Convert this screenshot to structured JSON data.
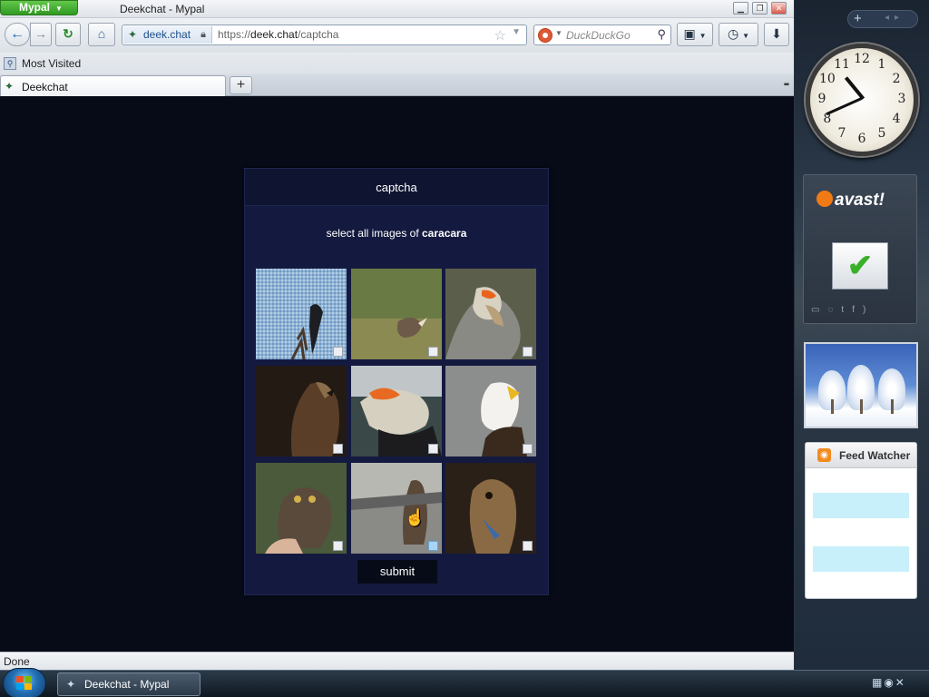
{
  "window": {
    "app_button": "Mypal",
    "title": "Deekchat - Mypal",
    "controls": {
      "minimize": "▁",
      "restore": "❐",
      "close": "✕"
    }
  },
  "navbar": {
    "back_icon": "←",
    "forward_icon": "→",
    "reload_icon": "↻",
    "home_icon": "⌂",
    "identity_site": "deek.chat",
    "url_prefix": "https://",
    "url_host": "deek.chat",
    "url_path": "/captcha",
    "search_placeholder": "DuckDuckGo",
    "bookmarks_icon": "▣",
    "history_icon": "◷",
    "download_icon": "⬇"
  },
  "bookmarks_toolbar": {
    "items": [
      {
        "label": "Most Visited"
      }
    ]
  },
  "tabs": {
    "items": [
      {
        "label": "Deekchat"
      }
    ],
    "new_tab": "+",
    "list_all": "▪▪"
  },
  "captcha": {
    "title": "captcha",
    "instruction_prefix": "select all images of ",
    "instruction_subject": "caracara",
    "tiles": [
      {
        "selected": false
      },
      {
        "selected": false
      },
      {
        "selected": false
      },
      {
        "selected": false
      },
      {
        "selected": false
      },
      {
        "selected": false
      },
      {
        "selected": false
      },
      {
        "selected": true
      },
      {
        "selected": false
      }
    ],
    "submit_label": "submit"
  },
  "status": {
    "text": "Done"
  },
  "sidebar": {
    "plus": "+",
    "nav_arrows": "◂▸",
    "clock": {
      "numbers": [
        "12",
        "1",
        "2",
        "3",
        "4",
        "5",
        "6",
        "7",
        "8",
        "9",
        "10",
        "11"
      ],
      "hour": 10,
      "minute": 41
    },
    "avast": {
      "brand": "avast!",
      "status_icon": "✔"
    },
    "feed": {
      "title": "Feed Watcher",
      "icon": "◉"
    }
  },
  "taskbar": {
    "items": [
      {
        "label": "Deekchat - Mypal"
      }
    ],
    "tray": "▦◉✕"
  },
  "colors": {
    "page_bg": "#070b18",
    "captcha_panel": "#141a3f",
    "app_button": "#2f9a22",
    "selected_checkbox": "#a9d4f5"
  }
}
